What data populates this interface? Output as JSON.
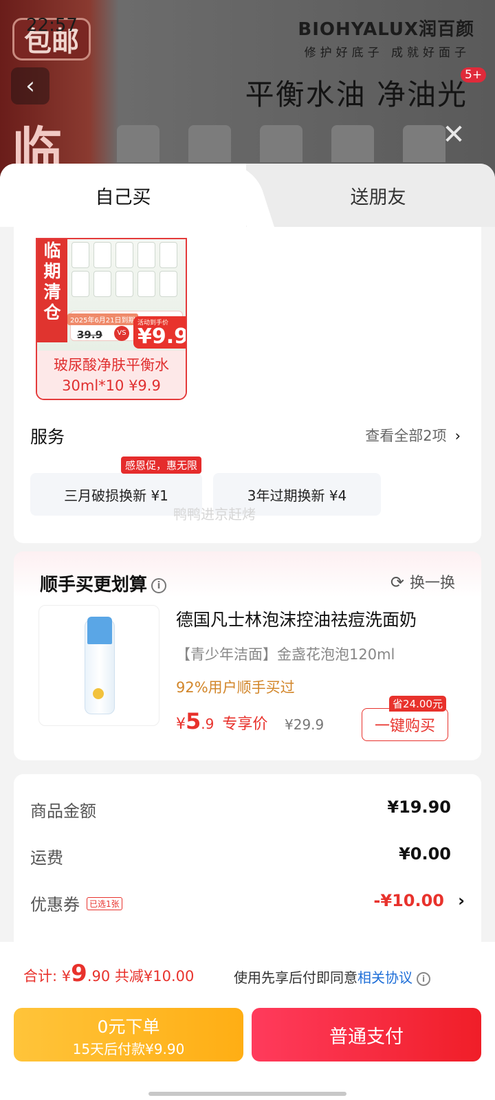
{
  "background": {
    "status_time": "22:57",
    "badge": "包邮",
    "side_char": "临",
    "brand": "BIOHYALUX润百颜",
    "brand_tagline": "修护好底子 成就好面子",
    "slogan": "平衡水油 净油光",
    "count_badge": "5+",
    "back_icon": "‹",
    "close_icon": "✕"
  },
  "tabs": [
    {
      "label": "自己买",
      "active": true
    },
    {
      "label": "送朋友",
      "active": false
    }
  ],
  "promo_image": {
    "side_text": "临期清仓",
    "expire_label": "2025年6月21日到期",
    "old_price": "39.9",
    "vs": "VS",
    "activity_label": "活动到手价",
    "activity_price": "¥9.9",
    "caption_line1": "玻尿酸净肤平衡水",
    "caption_line2": "30ml*10 ¥9.9"
  },
  "service": {
    "title": "服务",
    "view_all": "查看全部2项",
    "chevron": "›",
    "tag": "感恩促，惠无限",
    "items": [
      {
        "label": "三月破损换新  ¥1"
      },
      {
        "label": "3年过期换新  ¥4"
      }
    ],
    "watermark": "鸭鸭进京赶烤"
  },
  "addon": {
    "title": "顺手买更划算",
    "info_icon": "i",
    "swap_icon": "⟳",
    "swap_label": "换一换",
    "product_name": "德国凡士林泡沫控油祛痘洗面奶",
    "product_sub": "【青少年洁面】金盏花泡泡120ml",
    "product_stat": "92%用户顺手买过",
    "price_symbol": "¥",
    "price_int": "5",
    "price_dec": ".9",
    "price_label": "专享价",
    "original_price": "¥29.9",
    "save_tag": "省24.00元",
    "buy_label": "一键购买"
  },
  "summary": {
    "rows": [
      {
        "label": "商品金额",
        "value": "¥19.90"
      },
      {
        "label": "运费",
        "value": "¥0.00"
      },
      {
        "label": "优惠券",
        "chip": "已选1张",
        "value": "-¥10.00",
        "chevron": "›"
      }
    ]
  },
  "bottom": {
    "total_label": "合计: ",
    "total_symbol": "¥",
    "total_int": "9",
    "total_dec": ".90",
    "total_discount": " 共减¥10.00",
    "agree_text": "使用先享后付即同意",
    "agree_link": "相关协议",
    "info_icon": "i",
    "pay_later_line1": "0元下单",
    "pay_later_line2": "15天后付款¥9.90",
    "pay_normal": "普通支付"
  },
  "colors": {
    "accent": "#e8322c",
    "pay_later": "#ffae14",
    "link": "#1f6fd8"
  }
}
